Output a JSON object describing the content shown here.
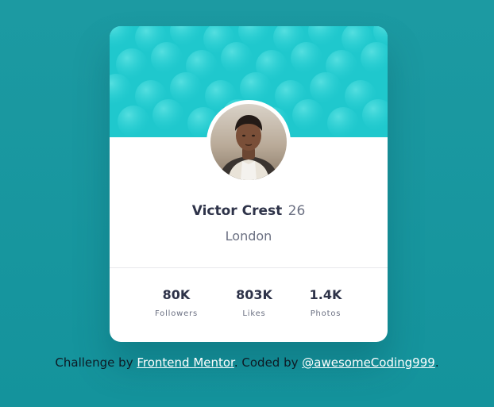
{
  "colors": {
    "page_background": "#1a9aa3",
    "banner": "#1fc8cd",
    "card": "#ffffff",
    "dark_text": "#2e3349",
    "muted_text": "#6b7082",
    "link": "#ffffff"
  },
  "profile": {
    "name": "Victor Crest",
    "age": "26",
    "location": "London",
    "avatar_icon": "user-photo-icon"
  },
  "stats": [
    {
      "value": "80K",
      "label": "Followers"
    },
    {
      "value": "803K",
      "label": "Likes"
    },
    {
      "value": "1.4K",
      "label": "Photos"
    }
  ],
  "attribution": {
    "challenge_prefix": "Challenge by",
    "challenge_link": "Frontend Mentor",
    "coded_prefix": "Coded by",
    "coded_link": "@awesomeCoding999"
  }
}
